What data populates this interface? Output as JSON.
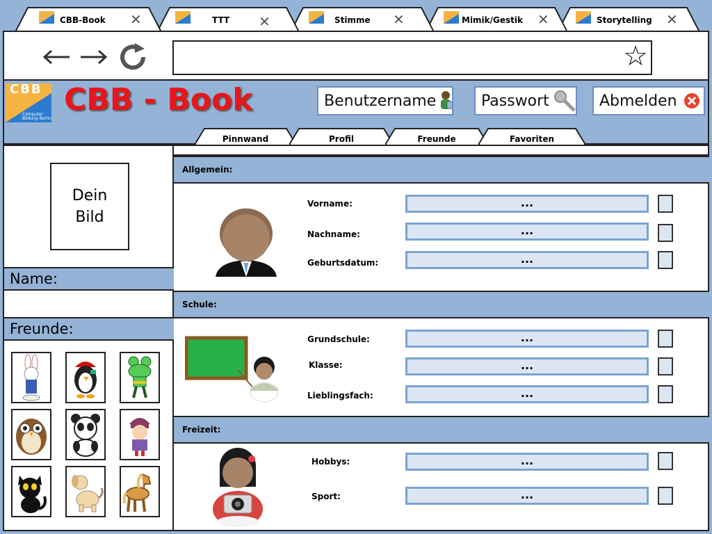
{
  "browser": {
    "tabs": [
      {
        "label": "CBB-Book",
        "active": true
      },
      {
        "label": "TTT",
        "active": false
      },
      {
        "label": "Stimme",
        "active": false
      },
      {
        "label": "Mimik/Gestik",
        "active": false
      },
      {
        "label": "Storytelling",
        "active": false
      }
    ],
    "close_glyph": "✕",
    "back_glyph": "←",
    "forward_glyph": "→",
    "reload_glyph": "⟳",
    "star_glyph": "☆",
    "url_value": ""
  },
  "header": {
    "logo_text": "CBB",
    "logo_subtext": "Computer Bildung Berlin",
    "title": "CBB - Book",
    "username_label": "Benutzername",
    "password_label": "Passwort",
    "logout_label": "Abmelden"
  },
  "page_tabs": [
    {
      "label": "Pinnwand"
    },
    {
      "label": "Profil",
      "active": true
    },
    {
      "label": "Freunde"
    },
    {
      "label": "Favoriten"
    }
  ],
  "sidebar": {
    "picture_placeholder_line1": "Dein",
    "picture_placeholder_line2": "Bild",
    "name_label": "Name:",
    "name_value": "",
    "friends_label": "Freunde:",
    "friends": [
      {
        "icon": "rabbit-icon"
      },
      {
        "icon": "penguin-pirate-icon"
      },
      {
        "icon": "frog-icon"
      },
      {
        "icon": "owl-icon"
      },
      {
        "icon": "panda-icon"
      },
      {
        "icon": "girl-icon"
      },
      {
        "icon": "cat-icon"
      },
      {
        "icon": "dog-icon"
      },
      {
        "icon": "horse-icon"
      }
    ]
  },
  "sections": {
    "allgemein": {
      "title": "Allgemein:",
      "fields": [
        {
          "label": "Vorname:",
          "value": "..."
        },
        {
          "label": "Nachname:",
          "value": "..."
        },
        {
          "label": "Geburtsdatum:",
          "value": "..."
        }
      ]
    },
    "schule": {
      "title": "Schule:",
      "fields": [
        {
          "label": "Grundschule:",
          "value": "..."
        },
        {
          "label": "Klasse:",
          "value": "..."
        },
        {
          "label": "Lieblingsfach:",
          "value": "..."
        }
      ]
    },
    "freizeit": {
      "title": "Freizeit:",
      "fields": [
        {
          "label": "Hobbys:",
          "value": "..."
        },
        {
          "label": "Sport:",
          "value": "..."
        }
      ]
    }
  },
  "colors": {
    "accent_blue": "#95b3d7",
    "field_fill": "#dce6f2",
    "field_border": "#7ba3d3",
    "title_red": "#e8151b"
  }
}
